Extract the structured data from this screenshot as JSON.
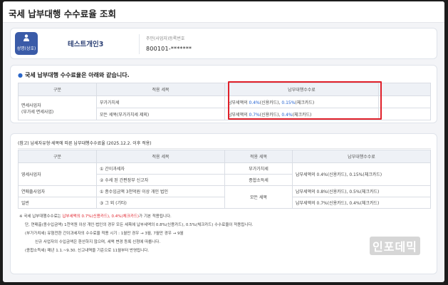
{
  "header": {
    "title": "국세 납부대행 수수료율 조회"
  },
  "user": {
    "avatar_label": "성명(상호)",
    "name": "테스트개인3",
    "reg_label": "주민(사업자)등록번호",
    "reg_value": "800101-*******"
  },
  "fee_section": {
    "heading": "국세 납부대행 수수료율은 아래와 같습니다.",
    "columns": [
      "구분",
      "적용 세목",
      "납부대행수수료"
    ],
    "category": "면세사업자",
    "category_sub": "(부가세 면세사업)",
    "rows": [
      {
        "tax_item": "부가가치세",
        "fee_prefix": "납부세액의 ",
        "fee_credit": "0.4%",
        "fee_mid": "(신용카드), ",
        "fee_check": "0.15%",
        "fee_suffix": "(체크카드)"
      },
      {
        "tax_item": "모든 세목(부가가치세 제외)",
        "fee_prefix": "납부세액의 ",
        "fee_credit": "0.7%",
        "fee_mid": "(신용카드), ",
        "fee_check": "0.4%",
        "fee_suffix": "(체크카드)"
      }
    ]
  },
  "reference": {
    "heading": "(참고) 납세자유형·세목에 따른 납부대행수수료율 (2025.12.2. 이후 적용)",
    "columns": [
      "구분",
      "적용 세목",
      "적용 세목",
      "납부대행수수료"
    ],
    "rows": [
      {
        "group": "영세사업자",
        "cond": "① 간이과세자",
        "tax": "부가가치세",
        "fee": "납부세액의 0.4%(신용카드), 0.15%(체크카드)"
      },
      {
        "group": "",
        "cond": "② 수세 된 간편장부 신고자",
        "tax": "종합소득세",
        "fee": ""
      },
      {
        "group": "연매출사업자",
        "cond": "① 종수입금액 3천억원 이상 개인 법인",
        "tax": "",
        "fee": "납부세액의 0.8%(신용카드), 0.5%(체크카드)"
      },
      {
        "group": "일반",
        "cond": "③ 그 외 (기타)",
        "tax": "모든 세목",
        "fee": "납부세액의 0.7%(신용카드), 0.4%(체크카드)"
      }
    ],
    "notes": [
      {
        "pre": "※ 국세 납부대행수수료는 ",
        "hl": "납부세액의 0.7%(신용카드), 0.4%(체크카드)",
        "post": "가 기본 적용됩니다."
      },
      {
        "pre": "단, 연매출(종수입금액) 1천억원 이상 개인·법인의 경우 모든 세목에 납부세액의 0.8%(신용카드), 0.5%(체크카드) 수수료율이 적용됩니다.",
        "hl": "",
        "post": ""
      },
      {
        "pre": "(부가가치세) 유형전환 간이과세자의 수수료율 적용 시기 : 1월만 경우 → 3월, 7월만 경우 → 9월",
        "hl": "",
        "post": ""
      },
      {
        "pre": "신규 사업자의 수입금액은 환산하지 않으며, 세액 변경 등록 신청에 따릅니다.",
        "hl": "",
        "post": ""
      },
      {
        "pre": "(종합소득세) 매년 1.1.~9.30. 신고내역을 기준으로 11월부터 반영됩니다.",
        "hl": "",
        "post": ""
      }
    ]
  },
  "watermark": "인포데믹",
  "colors": {
    "accent": "#3a5ba8",
    "link_blue": "#1f5fd1",
    "highlight_red": "#e0202a"
  }
}
